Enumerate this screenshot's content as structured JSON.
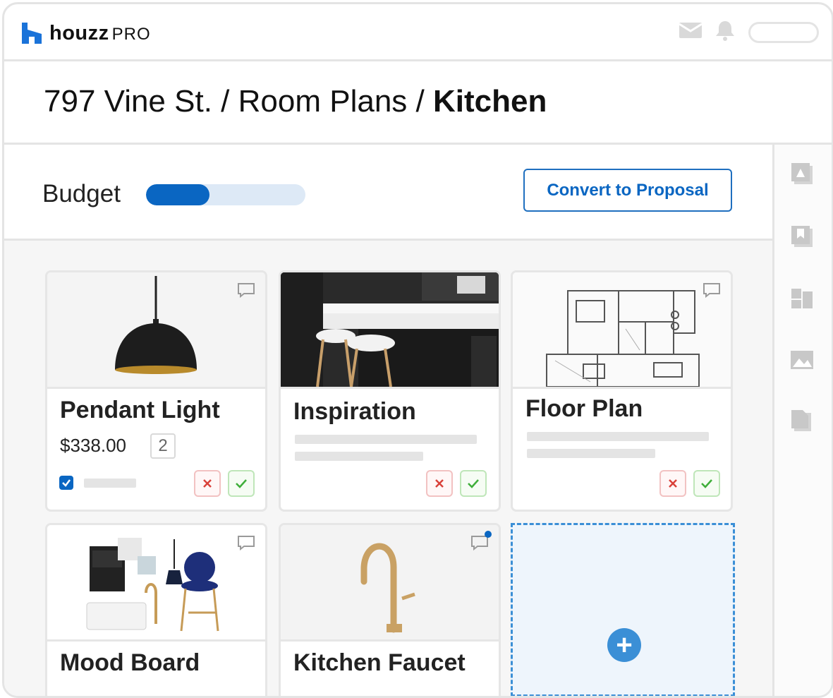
{
  "app": {
    "logo_wordmark": "houzz",
    "logo_suffix": "PRO"
  },
  "header": {
    "icons": [
      "mail-icon",
      "bell-icon"
    ]
  },
  "breadcrumb": {
    "part1": "797 Vine St.",
    "sep": " / ",
    "part2": "Room Plans",
    "current": "Kitchen"
  },
  "budget": {
    "label": "Budget",
    "progress_fraction": 0.4
  },
  "actions": {
    "convert_label": "Convert to Proposal"
  },
  "sidebar": {
    "icons": [
      "product-icon",
      "bookmark-icon",
      "layout-icon",
      "image-icon",
      "document-icon"
    ]
  },
  "cards": [
    {
      "title": "Pendant Light",
      "price": "$338.00",
      "qty": "2",
      "checked": true
    },
    {
      "title": "Inspiration"
    },
    {
      "title": "Floor Plan"
    },
    {
      "title": "Mood Board"
    },
    {
      "title": "Kitchen Faucet",
      "has_notification": true
    }
  ],
  "add_tile": {
    "icon": "plus-icon"
  },
  "colors": {
    "accent": "#0a66c2",
    "add_tile": "#3b8fd6",
    "reject": "#d9413a",
    "approve": "#3fae3a"
  }
}
